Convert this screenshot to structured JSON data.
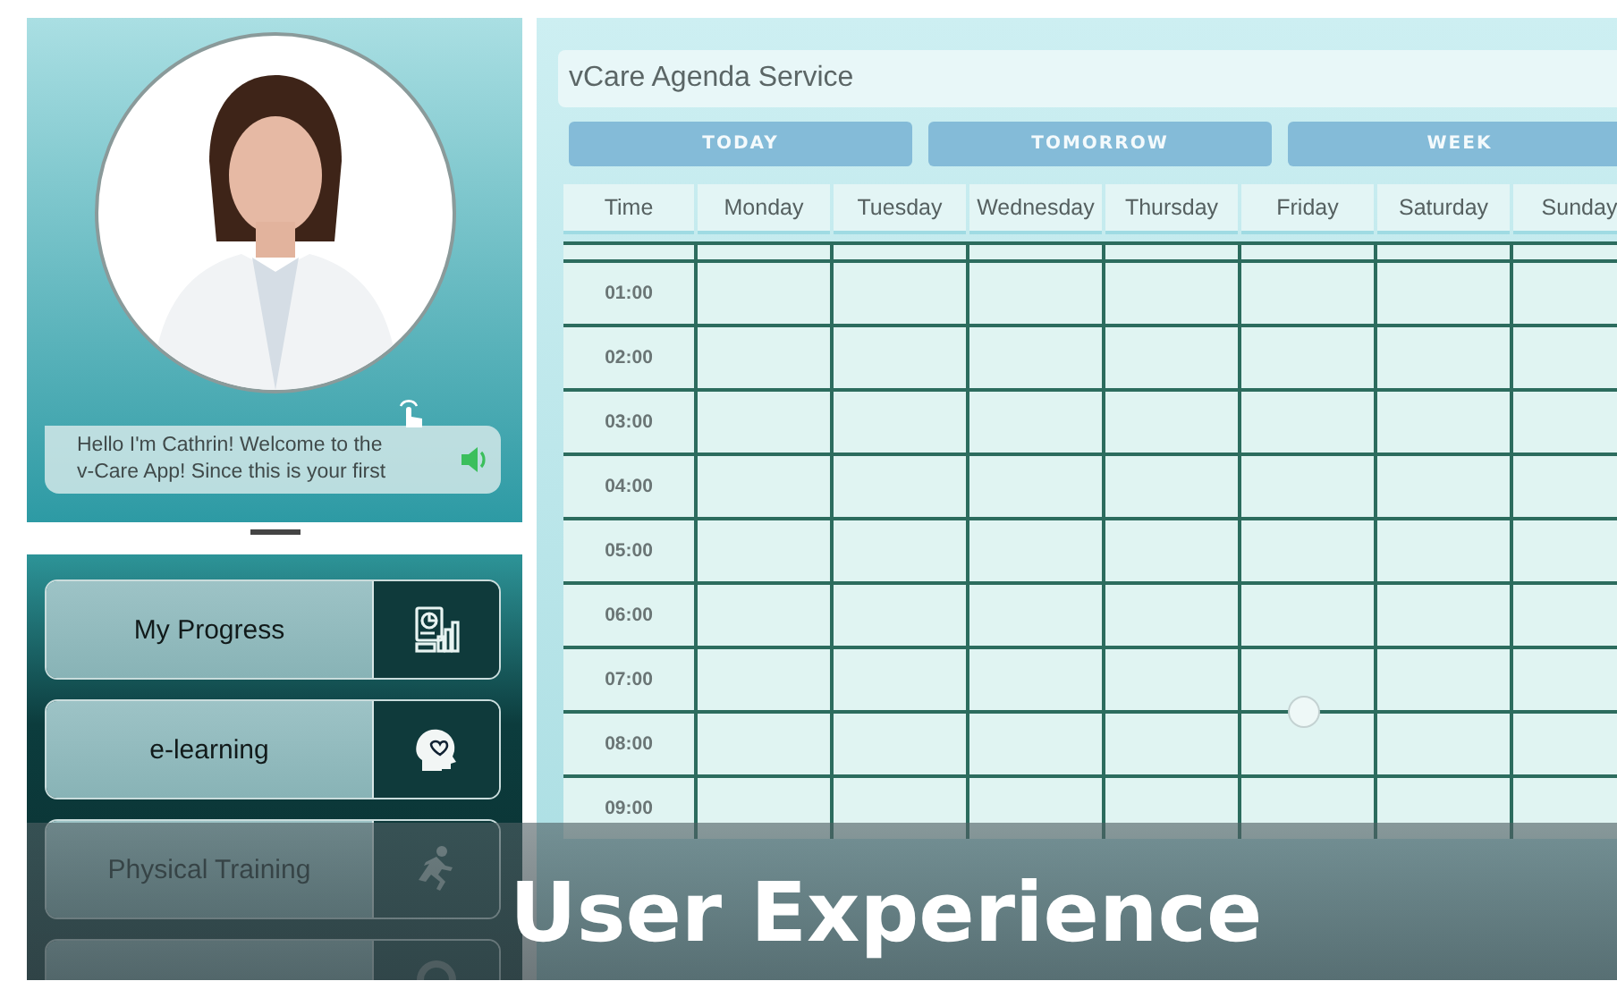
{
  "assistant": {
    "message": "Hello I'm Cathrin! Welcome to the\nv-Care App! Since this is your first"
  },
  "menu": [
    {
      "label": "My Progress",
      "kind": "chart"
    },
    {
      "label": "e-learning",
      "kind": "head"
    },
    {
      "label": "Physical Training",
      "kind": "runner"
    },
    {
      "kind": "gauge"
    }
  ],
  "agenda": {
    "title": "vCare Agenda Service",
    "tabs": [
      {
        "label": "TODAY",
        "selected": false
      },
      {
        "label": "TOMORROW",
        "selected": false
      },
      {
        "label": "WEEK",
        "selected": false
      }
    ],
    "columns": [
      "Time",
      "Monday",
      "Tuesday",
      "Wednesday",
      "Thursday",
      "Friday",
      "Saturday",
      "Sunday"
    ],
    "rows": [
      "01:00",
      "02:00",
      "03:00",
      "04:00",
      "05:00",
      "06:00",
      "07:00",
      "08:00",
      "09:00"
    ]
  },
  "caption": "User Experience"
}
